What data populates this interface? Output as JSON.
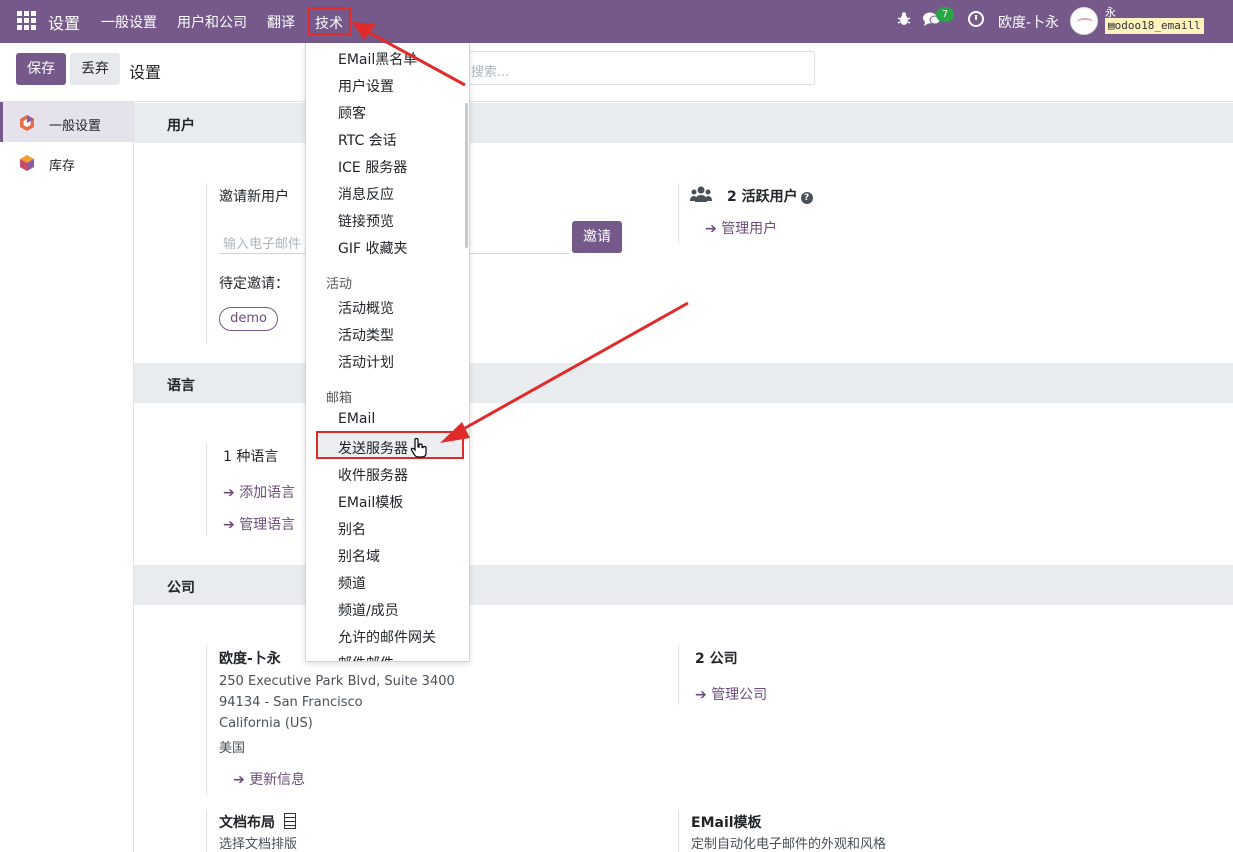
{
  "navbar": {
    "brand": "设置",
    "menus": [
      "一般设置",
      "用户和公司",
      "翻译",
      "技术"
    ],
    "chat_count": "7",
    "company": "欧度-卜永",
    "user": "永",
    "database": "odoo18_emaill"
  },
  "control": {
    "save_label": "保存",
    "discard_label": "丢弃",
    "title": "设置",
    "search_placeholder": "搜索..."
  },
  "sidebar": {
    "items": [
      {
        "label": "一般设置"
      },
      {
        "label": "库存"
      }
    ]
  },
  "sections": {
    "users": {
      "title": "用户",
      "invite_label": "邀请新用户",
      "email_placeholder": "输入电子邮件",
      "invite_button": "邀请",
      "pending_label": "待定邀请：",
      "pending_tag": "demo",
      "active_users": "2 活跃用户",
      "manage_users": "管理用户"
    },
    "languages": {
      "title": "语言",
      "count": "1 种语言",
      "add_language": "添加语言",
      "manage_languages": "管理语言"
    },
    "companies": {
      "title": "公司",
      "company_name": "欧度-卜永",
      "address_1": "250 Executive Park Blvd, Suite 3400",
      "address_2": "94134 - San Francisco",
      "address_3": "California (US)",
      "address_4": "美国",
      "update_info": "更新信息",
      "count": "2 公司",
      "manage_companies": "管理公司",
      "doc_layout_title": "文档布局",
      "doc_layout_desc": "选择文档排版",
      "email_template_title": "EMail模板",
      "email_template_desc": "定制自动化电子邮件的外观和风格"
    }
  },
  "dropdown": {
    "items_top": [
      "EMail黑名单",
      "用户设置",
      "顾客",
      "RTC 会话",
      "ICE 服务器",
      "消息反应",
      "链接预览",
      "GIF 收藏夹"
    ],
    "group_activity": "活动",
    "items_activity": [
      "活动概览",
      "活动类型",
      "活动计划"
    ],
    "group_mail": "邮箱",
    "items_mail": [
      "EMail",
      "发送服务器",
      "收件服务器",
      "EMail模板",
      "别名",
      "别名域",
      "频道",
      "频道/成员",
      "允许的邮件网关",
      "邮件邮件"
    ]
  },
  "colors": {
    "brand": "#74598a",
    "annotation": "#e02b2b",
    "badge": "#28a745"
  }
}
